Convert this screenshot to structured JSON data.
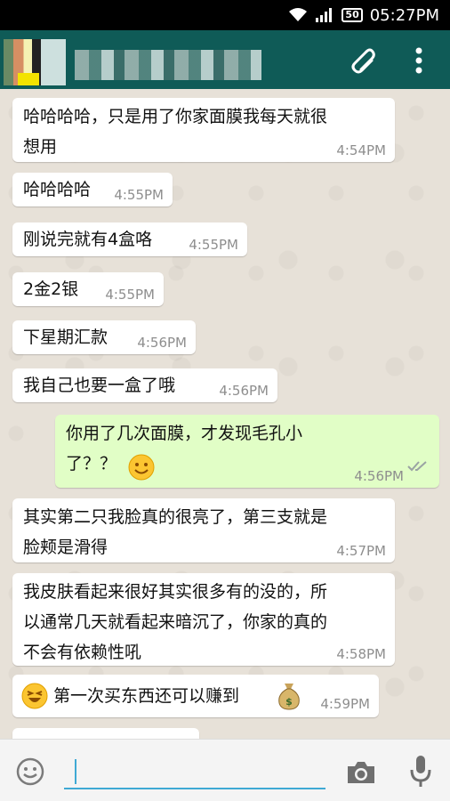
{
  "status_bar": {
    "time": "05:27PM",
    "battery": "50"
  },
  "chat": {
    "messages": [
      {
        "direction": "in",
        "text": "哈哈哈哈，只是用了你家面膜我每天就很\n想用",
        "time": "4:54PM"
      },
      {
        "direction": "in",
        "text": "哈哈哈哈",
        "time": "4:55PM"
      },
      {
        "direction": "in",
        "text": "刚说完就有4盒咯",
        "time": "4:55PM"
      },
      {
        "direction": "in",
        "text": "2金2银",
        "time": "4:55PM"
      },
      {
        "direction": "in",
        "text": "下星期汇款",
        "time": "4:56PM"
      },
      {
        "direction": "in",
        "text": "我自己也要一盒了哦",
        "time": "4:56PM"
      },
      {
        "direction": "out",
        "text": "你用了几次面膜，才发现毛孔小\n了？？",
        "time": "4:56PM",
        "emoji": "smile-emoji"
      },
      {
        "direction": "in",
        "text": "其实第二只我脸真的很亮了，第三支就是\n脸颊是滑得",
        "time": "4:57PM"
      },
      {
        "direction": "in",
        "text": "我皮肤看起来很好其实很多有的没的，所\n以通常几天就看起来暗沉了，你家的真的\n不会有依赖性吼",
        "time": "4:58PM"
      },
      {
        "direction": "in",
        "text": "第一次买东西还可以赚到",
        "time": "4:59PM",
        "emoji_left": "laughing-emoji",
        "emoji_right": "money-bag-emoji"
      }
    ]
  },
  "colors": {
    "app_bar": "#0f5b57",
    "outgoing": "#e1fec6",
    "incoming": "#ffffff",
    "input_accent": "#3fa9d4"
  },
  "input": {
    "value": "",
    "placeholder": ""
  }
}
